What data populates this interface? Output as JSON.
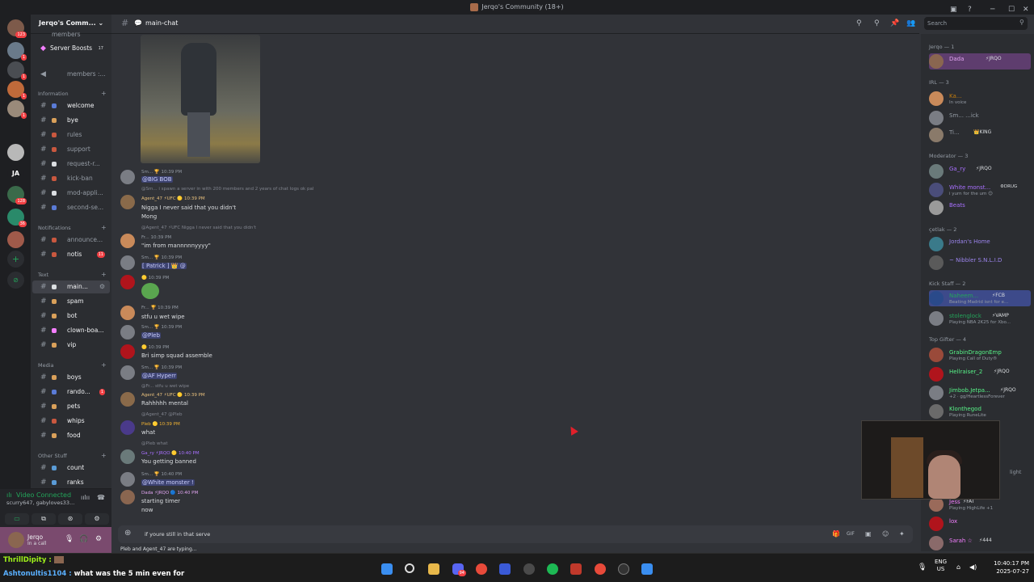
{
  "window": {
    "title": "Jerqo's Community (18+)",
    "minimize": "─",
    "maximize": "☐",
    "close": "✕",
    "inbox_icon": "▣",
    "help_icon": "?"
  },
  "guilds": {
    "items": [
      {
        "label": "",
        "badge": "123"
      },
      {
        "label": "",
        "badge": "1"
      },
      {
        "label": "",
        "badge": "1"
      },
      {
        "label": "",
        "badge": "1"
      },
      {
        "label": "",
        "badge": "1"
      },
      {
        "label": "",
        "badge": ""
      },
      {
        "label": "JA",
        "badge": ""
      },
      {
        "label": "",
        "badge": "128"
      },
      {
        "label": "",
        "badge": "36"
      },
      {
        "label": "",
        "badge": ""
      }
    ],
    "add_icon": "+",
    "explore_icon": "⊘"
  },
  "server": {
    "name": "Jerqo's Comm...",
    "dropdown_icon": "⌄",
    "members_partial": "members",
    "boosts": {
      "label": "Server Boosts",
      "count": "17"
    },
    "voice_members": "members :...",
    "categories": {
      "information": "Information",
      "notifications": "Notifications",
      "text": "Text",
      "media": "Media",
      "other": "Other Stuff"
    },
    "channels": {
      "welcome": "welcome",
      "bye": "bye",
      "rules": "rules",
      "support": "support",
      "request": "request-r...",
      "kick_ban": "kick-ban",
      "mod_apply": "mod-appli...",
      "second": "second-se...",
      "announce": "announce...",
      "notis": {
        "name": "notis",
        "badge": "11"
      },
      "main": "main...",
      "spam": "spam",
      "bot": "bot",
      "clown": "clown-boa...",
      "vip": "vip",
      "boys": "boys",
      "random": {
        "name": "rando...",
        "badge": "1"
      },
      "pets": "pets",
      "whips": "whips",
      "food": "food",
      "count": "count",
      "ranks": "ranks"
    }
  },
  "voice": {
    "status": "Video Connected",
    "channel": "scurry647, gabyloves33...",
    "buttons": [
      "▭",
      "⧉",
      "⊛",
      "⚙"
    ]
  },
  "user": {
    "name": "Jerqo",
    "status": "In a call",
    "mic": "🎙",
    "headset": "🎧",
    "settings": "⚙"
  },
  "chat": {
    "channel": "main-chat",
    "header_icons": [
      "⚲",
      "⚲",
      "📌",
      "👥"
    ],
    "search_placeholder": "Search",
    "messages": [
      {
        "reply": "",
        "meta": "Sm... 🏆 10:39 PM",
        "text": "@BIG BOB"
      },
      {
        "reply": "@Sm... i spawn a server in with 200 members and 2 years of chat logs ok pal",
        "meta": "Agent_47 ⚡UFC 🟡 10:39 PM",
        "text": "Nigga I never said that you didn't",
        "text2": "Mong"
      },
      {
        "reply": "@Agent_47 ⚡UFC Nigga I never said that you didn't",
        "meta": "Fr... 10:39 PM",
        "text": "\"im from mannnnnyyyy\""
      },
      {
        "reply": "",
        "meta": "Sm... 🏆 10:39 PM",
        "text": "[ Patrick ] 👑 @"
      },
      {
        "reply": "",
        "meta": "🟡 10:39 PM",
        "text": ""
      },
      {
        "reply": "",
        "meta": "Fr... 🏆 10:39 PM",
        "text": "stfu u wet wipe"
      },
      {
        "reply": "",
        "meta": "Sm... 🏆 10:39 PM",
        "text": "@Pleb"
      },
      {
        "reply": "",
        "meta": "🟡 10:39 PM",
        "text": "Bri simp squad assemble"
      },
      {
        "reply": "",
        "meta": "Sm... 🏆 10:39 PM",
        "text": "@AF Hyperr"
      },
      {
        "reply": "@Fr... stfu u wet wipe",
        "meta": "Agent_47 ⚡UFC 🟡 10:39 PM",
        "text": "Rahhhhh mental"
      },
      {
        "reply": "@Agent_47 @Pleb",
        "meta": "Pleb 🟡 10:39 PM",
        "text": "what"
      },
      {
        "reply": "@Pleb what",
        "meta": "Ga_ry ⚡JRQO 🟡 10:40 PM",
        "text": "You getting banned"
      },
      {
        "reply": "",
        "meta": "Sm... 🏆 10:40 PM",
        "text": "@White monster !"
      },
      {
        "reply": "",
        "meta": "Dada ⚡JRQO 🔵 10:40 PM",
        "text": "starting timer",
        "text2": "now"
      }
    ],
    "composer_text": "if youre still in that serve",
    "composer_icons": [
      "🎁",
      "GIF",
      "▣",
      "☺",
      "✦"
    ],
    "typing": "Pleb and Agent_47 are typing..."
  },
  "members": {
    "groups": [
      {
        "label": "Jerqo — 1",
        "items": [
          {
            "name": "Dada",
            "sub": "",
            "tag": "⚡JRQO",
            "color": "#e0a4f0"
          }
        ]
      },
      {
        "label": "IRL — 3",
        "items": [
          {
            "name": "Ka...",
            "sub": "In voice",
            "tag": "",
            "color": "#c27c0e"
          },
          {
            "name": "Sm... ...ick",
            "sub": "",
            "tag": "",
            "color": "#949ba4"
          },
          {
            "name": "Ti...",
            "sub": "",
            "tag": "👑KING",
            "color": "#949ba4"
          }
        ]
      },
      {
        "label": "Moderator — 3",
        "items": [
          {
            "name": "Ga_ry",
            "sub": "",
            "tag": "⚡JRQO",
            "color": "#a970ff"
          },
          {
            "name": "White monst...",
            "sub": "i yurn for the um 😊",
            "tag": "⚙DRUG",
            "color": "#a970ff"
          },
          {
            "name": "Beats",
            "sub": "",
            "tag": "",
            "color": "#a970ff"
          }
        ]
      },
      {
        "label": "çetlak — 2",
        "items": [
          {
            "name": "Jordan's Home",
            "sub": "",
            "tag": "",
            "color": "#9b84ec"
          },
          {
            "name": "~ Nibbler S.N.L.I.D",
            "sub": "",
            "tag": "",
            "color": "#9b84ec"
          }
        ]
      },
      {
        "label": "Kick Staff — 2",
        "items": [
          {
            "name": "Naheem...",
            "sub": "Beating Madrid isnt for e...",
            "tag": "⚡FCB",
            "color": "#23a55a"
          },
          {
            "name": "stolenglock",
            "sub": "Playing NBA 2K25 for Xbo...",
            "tag": "⚡VAMP",
            "color": "#23a55a"
          }
        ]
      },
      {
        "label": "Top Gifter — 4",
        "items": [
          {
            "name": "GrabinDragonEmp",
            "sub": "Playing Call of Duty®",
            "tag": "",
            "color": "#57f287"
          },
          {
            "name": "Hellraiser_2",
            "sub": "",
            "tag": "⚡JRQO",
            "color": "#57f287"
          },
          {
            "name": "Jimbob.Jetpa...",
            "sub": "+2 · gg/HeartlessForever",
            "tag": "⚡JRQO",
            "color": "#57f287"
          },
          {
            "name": "Klonthegod",
            "sub": "Playing RuneLite",
            "tag": "",
            "color": "#57f287"
          }
        ]
      },
      {
        "label": "",
        "items": [
          {
            "name": "Jess",
            "sub": "Playing HighLife +1",
            "tag": "⚡FAT",
            "color": "#f47fff"
          },
          {
            "name": "lox",
            "sub": "",
            "tag": "",
            "color": "#f47fff"
          },
          {
            "name": "Sarah ☆",
            "sub": "",
            "tag": "⚡444",
            "color": "#f47fff"
          }
        ]
      }
    ],
    "light_partial": "light"
  },
  "stream_overlay": {
    "lines": [
      {
        "user": "ThrillDipity :",
        "msg": "",
        "color": "#9ef01a"
      },
      {
        "user": "Ashtonultis1104 :",
        "msg": " what was the 5 min even for",
        "color": "#5ab0ff"
      }
    ]
  },
  "taskbar": {
    "lang": "ENG",
    "region": "US",
    "time": "10:40:17 PM",
    "date": "2025-07-27",
    "discord_badge": "94",
    "icons": [
      "windows-icon",
      "search-icon",
      "files-icon",
      "discord-icon",
      "chrome-icon",
      "app-icon",
      "steam-icon",
      "spotify-icon",
      "obs-icon",
      "chrome-icon",
      "obs-alt-icon",
      "app-icon"
    ]
  },
  "colors": {
    "accent": "#5865f2",
    "bg": "#313338",
    "sidebar": "#2b2d31",
    "online": "#23a55a",
    "user_panel": "#7a4a6e"
  }
}
